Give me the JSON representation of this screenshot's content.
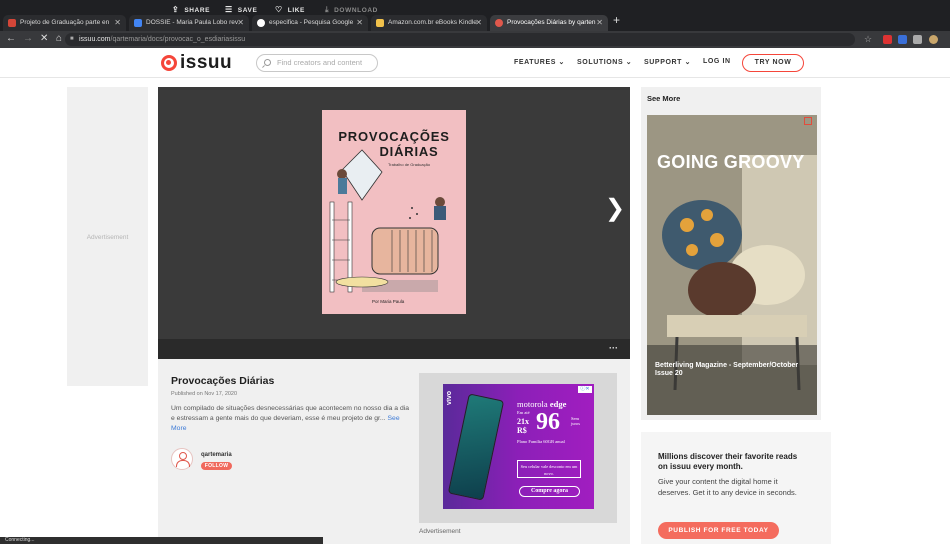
{
  "browser": {
    "tabs": [
      {
        "title": "Projeto de Graduação parte en",
        "favicon_color": "#d44638"
      },
      {
        "title": "DOSSIE - Maria Paula Lobo rev",
        "favicon_color": "#4285f4"
      },
      {
        "title": "especifica - Pesquisa Google",
        "favicon_color": "#ffffff"
      },
      {
        "title": "Amazon.com.br eBooks Kindle",
        "favicon_color": "#f0c14b"
      },
      {
        "title": "Provocações Diárias by qarten",
        "favicon_color": "#e0584c"
      }
    ],
    "new_tab": "+",
    "url_domain": "issuu.com",
    "url_path": "/qartemaria/docs/provocac_o_esdiariasissu"
  },
  "header": {
    "logo": "issuu",
    "search_placeholder": "Find creators and content",
    "nav": [
      {
        "label": "FEATURES ⌄"
      },
      {
        "label": "SOLUTIONS ⌄"
      },
      {
        "label": "SUPPORT ⌄"
      },
      {
        "label": "LOG IN"
      }
    ],
    "try_now": "TRY NOW"
  },
  "left_ad": {
    "label": "Advertisement"
  },
  "reader": {
    "cover_title_1": "PROVOCAÇÕES",
    "cover_title_2": "DIÁRIAS",
    "cover_sub": "Trabalho de Graduação",
    "cover_author": "Por Maria Paula",
    "toolbar": {
      "share": "SHARE",
      "save": "SAVE",
      "like": "LIKE",
      "download": "DOWNLOAD",
      "more": "···"
    }
  },
  "doc": {
    "title": "Provocações Diárias",
    "published": "Published on Nov 17, 2020",
    "description": "Um compilado de situações desnecessárias que acontecem no nosso dia a dia e estressam a gente mais do que deveriam, esse é meu projeto de gr...",
    "see_more": "See More",
    "author": "qartemaria",
    "follow": "FOLLOW"
  },
  "mid_ad": {
    "brand_prefix": "motorola",
    "brand": "edge",
    "small": "Em até",
    "pre": "21x",
    "currency": "R$",
    "price": "96",
    "sem": "Sem juros",
    "plan": "Plano Família 60GB anual",
    "box": "Seu celular vale desconto em um novo.",
    "cta": "Compre agora",
    "vivo": "vivo",
    "label": "Advertisement"
  },
  "see_more": {
    "heading": "See More",
    "mag_title": "GOING GROOVY",
    "caption": "Betterliving Magazine - September/October Issue 20"
  },
  "promo": {
    "title": "Millions discover their favorite reads on issuu every month.",
    "text": "Give your content the digital home it deserves. Get it to any device in seconds.",
    "button": "PUBLISH FOR FREE TODAY"
  },
  "status": "Connecting..."
}
